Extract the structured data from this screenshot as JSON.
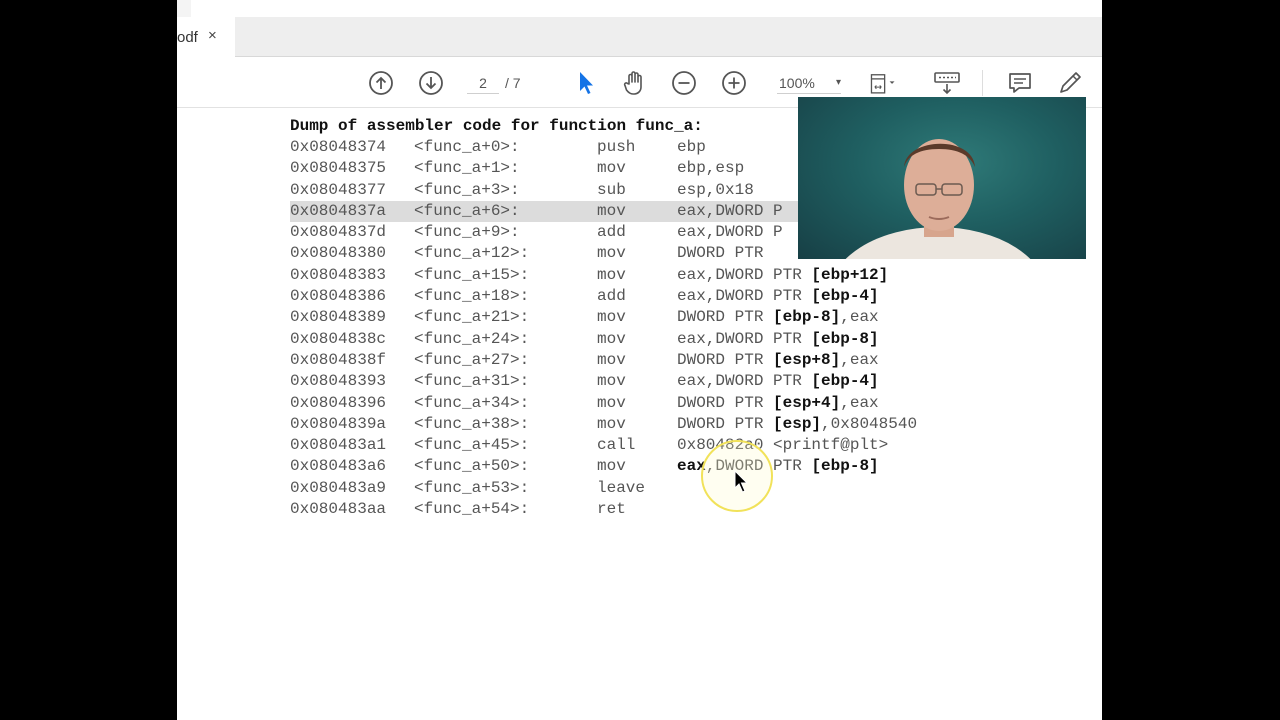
{
  "tab": {
    "title": "odf",
    "close": "×"
  },
  "toolbar": {
    "page_current": "2",
    "page_total": "/ 7",
    "zoom": "100%",
    "zoom_arrow": "▾",
    "accent": "#1473e6"
  },
  "code": {
    "title": "Dump of assembler code for function func_a:",
    "rows": [
      {
        "addr": "0x08048374",
        "sym": "<func_a+0>:",
        "mn": "push",
        "op": "ebp"
      },
      {
        "addr": "0x08048375",
        "sym": "<func_a+1>:",
        "mn": "mov",
        "op": "ebp,esp"
      },
      {
        "addr": "0x08048377",
        "sym": "<func_a+3>:",
        "mn": "sub",
        "op": "esp,0x18"
      },
      {
        "addr": "0x0804837a",
        "sym": "<func_a+6>:",
        "mn": "mov",
        "op": "eax,DWORD P",
        "highlighted": true
      },
      {
        "addr": "0x0804837d",
        "sym": "<func_a+9>:",
        "mn": "add",
        "op": "eax,DWORD P"
      },
      {
        "addr": "0x08048380",
        "sym": "<func_a+12>:",
        "mn": "mov",
        "op": "DWORD PTR"
      },
      {
        "addr": "0x08048383",
        "sym": "<func_a+15>:",
        "mn": "mov",
        "op_pre": "eax,DWORD PTR ",
        "op_bold": "[ebp+12]"
      },
      {
        "addr": "0x08048386",
        "sym": "<func_a+18>:",
        "mn": "add",
        "op_pre": "eax,DWORD PTR ",
        "op_bold": "[ebp-4]"
      },
      {
        "addr": "0x08048389",
        "sym": "<func_a+21>:",
        "mn": "mov",
        "op_pre": "DWORD PTR ",
        "op_bold": "[ebp-8]",
        "op_post": ",eax"
      },
      {
        "addr": "0x0804838c",
        "sym": "<func_a+24>:",
        "mn": "mov",
        "op_pre": "eax,DWORD PTR ",
        "op_bold": "[ebp-8]"
      },
      {
        "addr": "0x0804838f",
        "sym": "<func_a+27>:",
        "mn": "mov",
        "op_pre": "DWORD PTR ",
        "op_bold": "[esp+8]",
        "op_post": ",eax"
      },
      {
        "addr": "0x08048393",
        "sym": "<func_a+31>:",
        "mn": "mov",
        "op_pre": "eax,DWORD PTR ",
        "op_bold": "[ebp-4]"
      },
      {
        "addr": "0x08048396",
        "sym": "<func_a+34>:",
        "mn": "mov",
        "op_pre": "DWORD PTR ",
        "op_bold": "[esp+4]",
        "op_post": ",eax"
      },
      {
        "addr": "0x0804839a",
        "sym": "<func_a+38>:",
        "mn": "mov",
        "op_pre": "DWORD PTR ",
        "op_bold": "[esp]",
        "op_post": ",0x8048540"
      },
      {
        "addr": "0x080483a1",
        "sym": "<func_a+45>:",
        "mn": "call",
        "op": "0x80482a0 <printf@plt>"
      },
      {
        "addr": "0x080483a6",
        "sym": "<func_a+50>:",
        "mn": "mov",
        "op_bold_first": "eax",
        "op_pre": ",DWORD PTR ",
        "op_bold": "[ebp-8]"
      },
      {
        "addr": "0x080483a9",
        "sym": "<func_a+53>:",
        "mn": "leave",
        "op": ""
      },
      {
        "addr": "0x080483aa",
        "sym": "<func_a+54>:",
        "mn": "ret",
        "op": ""
      }
    ]
  }
}
